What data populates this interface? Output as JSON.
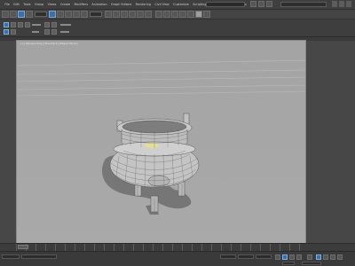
{
  "menu": {
    "items": [
      "File",
      "Edit",
      "Tools",
      "Group",
      "Views",
      "Create",
      "Modifiers",
      "Animation",
      "Graph Editors",
      "Rendering",
      "Civil View",
      "Customize",
      "Scripting",
      "Content",
      "Arnold",
      "Help"
    ]
  },
  "toolbar": {
    "selection_filter": "All",
    "view_dropdown": "View"
  },
  "viewport": {
    "label": "[+] [Perspective] [Standard] [Edged Faces]"
  },
  "timeline": {
    "frame_display": "0 / 100"
  },
  "status": {
    "selection": "1 Object Selected",
    "prompt": "Click or click-and-drag to select objects",
    "x_label": "X:",
    "y_label": "Y:",
    "z_label": "Z:",
    "grid": "Grid = 10.0",
    "auto_key": "Auto Key",
    "set_key": "Set Key",
    "selected": "Selected"
  },
  "colors": {
    "ui_bg": "#474747",
    "viewport_bg": "#a7a7a7",
    "accent": "#3f6da4"
  },
  "icons": [
    "undo-icon",
    "redo-icon",
    "link-icon",
    "select-icon",
    "move-icon",
    "rotate-icon",
    "scale-icon",
    "snap-icon",
    "render-icon",
    "play-icon",
    "key-icon"
  ]
}
